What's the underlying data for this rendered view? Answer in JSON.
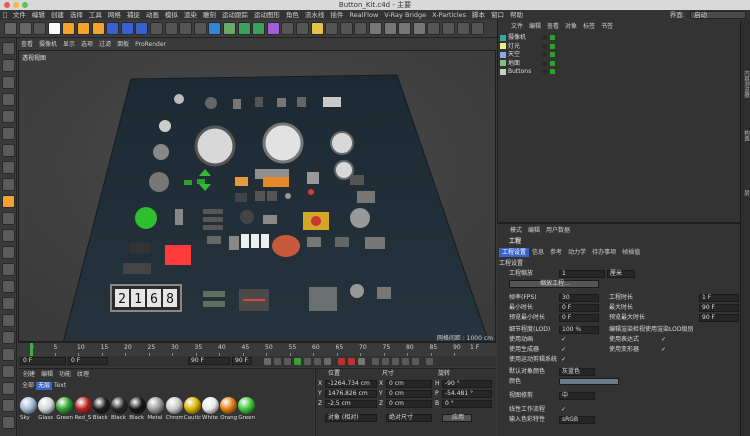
{
  "window": {
    "title": "Button_Kit.c4d - 主要"
  },
  "menubar": [
    "文件",
    "编辑",
    "创建",
    "选择",
    "工具",
    "网格",
    "捕捉",
    "动画",
    "模拟",
    "渲染",
    "雕刻",
    "运动跟踪",
    "运动图形",
    "角色",
    "流水线",
    "插件",
    "RealFlow",
    "V-Ray Bridge",
    "X-Particles",
    "脚本",
    "窗口",
    "帮助"
  ],
  "interface": {
    "label": "界面:",
    "value": "启动"
  },
  "viewport": {
    "menu": [
      "查看",
      "摄像机",
      "显示",
      "选项",
      "过滤",
      "面板",
      "ProRender"
    ],
    "label": "透视视图",
    "grid_label": "网格间距 : 1000 cm",
    "segment_display": [
      "2",
      "1",
      "6",
      "8"
    ]
  },
  "timeline": {
    "ticks": [
      "0",
      "5",
      "10",
      "15",
      "20",
      "25",
      "30",
      "35",
      "40",
      "45",
      "50",
      "55",
      "60",
      "65",
      "70",
      "75",
      "80",
      "85",
      "90"
    ],
    "current_frame": "0 F",
    "start": "0 F",
    "end": "90 F",
    "end2": "90 F",
    "frame_right": "1 F"
  },
  "materials": {
    "menu": [
      "创建",
      "编辑",
      "功能",
      "纹理"
    ],
    "tabs": [
      "全部",
      "无层",
      "Text"
    ],
    "items": [
      {
        "name": "Sky",
        "color": "#9fb8d6"
      },
      {
        "name": "Glass",
        "color": "#cfd6dc"
      },
      {
        "name": "Green",
        "color": "#2fa02f"
      },
      {
        "name": "Red_S",
        "color": "#b81f1f"
      },
      {
        "name": "Black",
        "color": "#1b1b1b"
      },
      {
        "name": "Black",
        "color": "#262626"
      },
      {
        "name": "Black",
        "color": "#151515"
      },
      {
        "name": "Metal",
        "color": "#9a9a9a"
      },
      {
        "name": "Chrom",
        "color": "#c9c9c9"
      },
      {
        "name": "Cautic",
        "color": "#d8b000"
      },
      {
        "name": "White",
        "color": "#e8e8e8"
      },
      {
        "name": "Orang",
        "color": "#e07a10"
      },
      {
        "name": "Green",
        "color": "#3cc43c"
      }
    ]
  },
  "coords": {
    "headers": [
      "位置",
      "尺寸",
      "旋转"
    ],
    "rows": [
      {
        "axis": "X",
        "pos": "-1264.734 cm",
        "size": "0 cm",
        "rot_axis": "H",
        "rot": "-90 °"
      },
      {
        "axis": "Y",
        "pos": "1476.826 cm",
        "size": "0 cm",
        "rot_axis": "P",
        "rot": "-54.481 °"
      },
      {
        "axis": "Z",
        "pos": "-2.5 cm",
        "size": "0 cm",
        "rot_axis": "B",
        "rot": "0 °"
      }
    ],
    "mode1": "对象 (相对)",
    "mode2": "绝对尺寸",
    "apply": "应用"
  },
  "objects": {
    "menu": [
      "文件",
      "编辑",
      "查看",
      "对象",
      "标签",
      "书签"
    ],
    "items": [
      "摄像机",
      "灯光",
      "天空",
      "地面",
      "Buttons"
    ]
  },
  "side_tabs": [
    "内容浏览器",
    "构造",
    "层"
  ],
  "attributes": {
    "menu": [
      "模式",
      "编辑",
      "用户数据"
    ],
    "title": "工程",
    "tabs": [
      "工程设置",
      "信息",
      "参考",
      "动力学",
      "待办事项",
      "帧插值"
    ],
    "section": "工程设置",
    "scale_label": "工程缩放",
    "scale_value": "1",
    "scale_unit": "厘米",
    "scale_button": "缩放工程...",
    "fps_label": "帧率(FPS)",
    "fps_value": "30",
    "project_time_label": "工程时长",
    "project_time_value": "1 F",
    "min_time_label": "最小时长",
    "min_time_value": "0 F",
    "max_time_label": "最大时长",
    "max_time_value": "90 F",
    "preview_min_label": "预览最小时长",
    "preview_min_value": "0 F",
    "preview_max_label": "预览最大时长",
    "preview_max_value": "90 F",
    "lod_label": "细节程度(LOD)",
    "lod_value": "100 %",
    "lod_render_label": "编辑渲染检视使用渲染LOD级别",
    "anim_label": "使用动画",
    "expr_label": "使用表达式",
    "gen_label": "使用生成器",
    "deform_label": "使用变形器",
    "motion_label": "使用运动剪辑系统",
    "obj_color_label": "默认对象颜色",
    "obj_color_value": "灰蓝色",
    "color_label": "颜色",
    "view_clip_label": "视图修剪",
    "view_clip_value": "中",
    "linear_label": "线性工作流程",
    "input_label": "输入色彩特性",
    "input_value": "sRGB"
  }
}
